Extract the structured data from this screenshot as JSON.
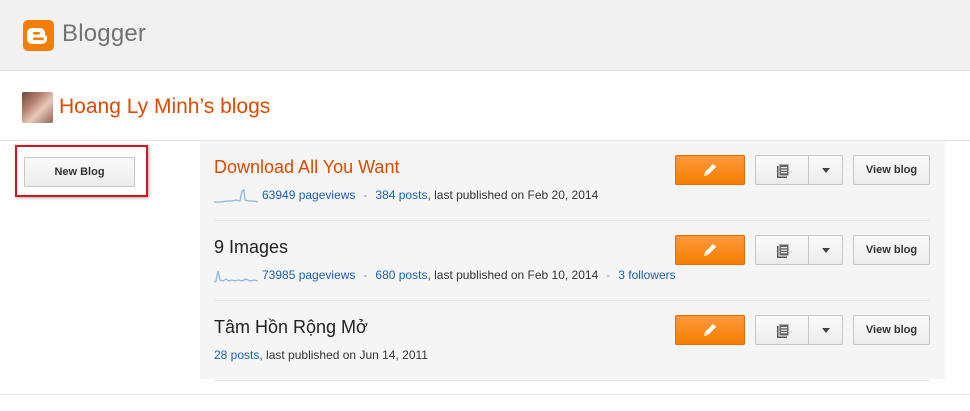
{
  "header": {
    "brand": "Blogger",
    "logo_icon": "blogger-logo-icon",
    "accent_color": "#f57d00"
  },
  "owner": {
    "title": "Hoang Ly Minh’s blogs",
    "avatar_icon": "avatar"
  },
  "sidebar": {
    "new_blog_label": "New Blog",
    "highlight_color": "#d6141e"
  },
  "blogs": [
    {
      "title": "Download All You Want",
      "pageviews": "63949 pageviews",
      "posts": "384 posts",
      "published": ", last published on Feb 20, 2014",
      "followers": "",
      "view_label": "View blog",
      "has_sparkline": true
    },
    {
      "title": "9 Images",
      "pageviews": "73985 pageviews",
      "posts": "680 posts",
      "published": ", last published on Feb 10, 2014",
      "followers": "3 followers",
      "view_label": "View blog",
      "has_sparkline": true
    },
    {
      "title": "Tâm Hồn Rộng Mở",
      "pageviews": "",
      "posts": "28 posts",
      "published": ", last published on Jun 14, 2011",
      "followers": "",
      "view_label": "View blog",
      "has_sparkline": false
    }
  ],
  "icons": {
    "edit": "pencil-icon",
    "posts": "document-list-icon",
    "dropdown": "chevron-down-icon",
    "sparkline": "pageviews-sparkline-icon"
  },
  "separator": "-"
}
